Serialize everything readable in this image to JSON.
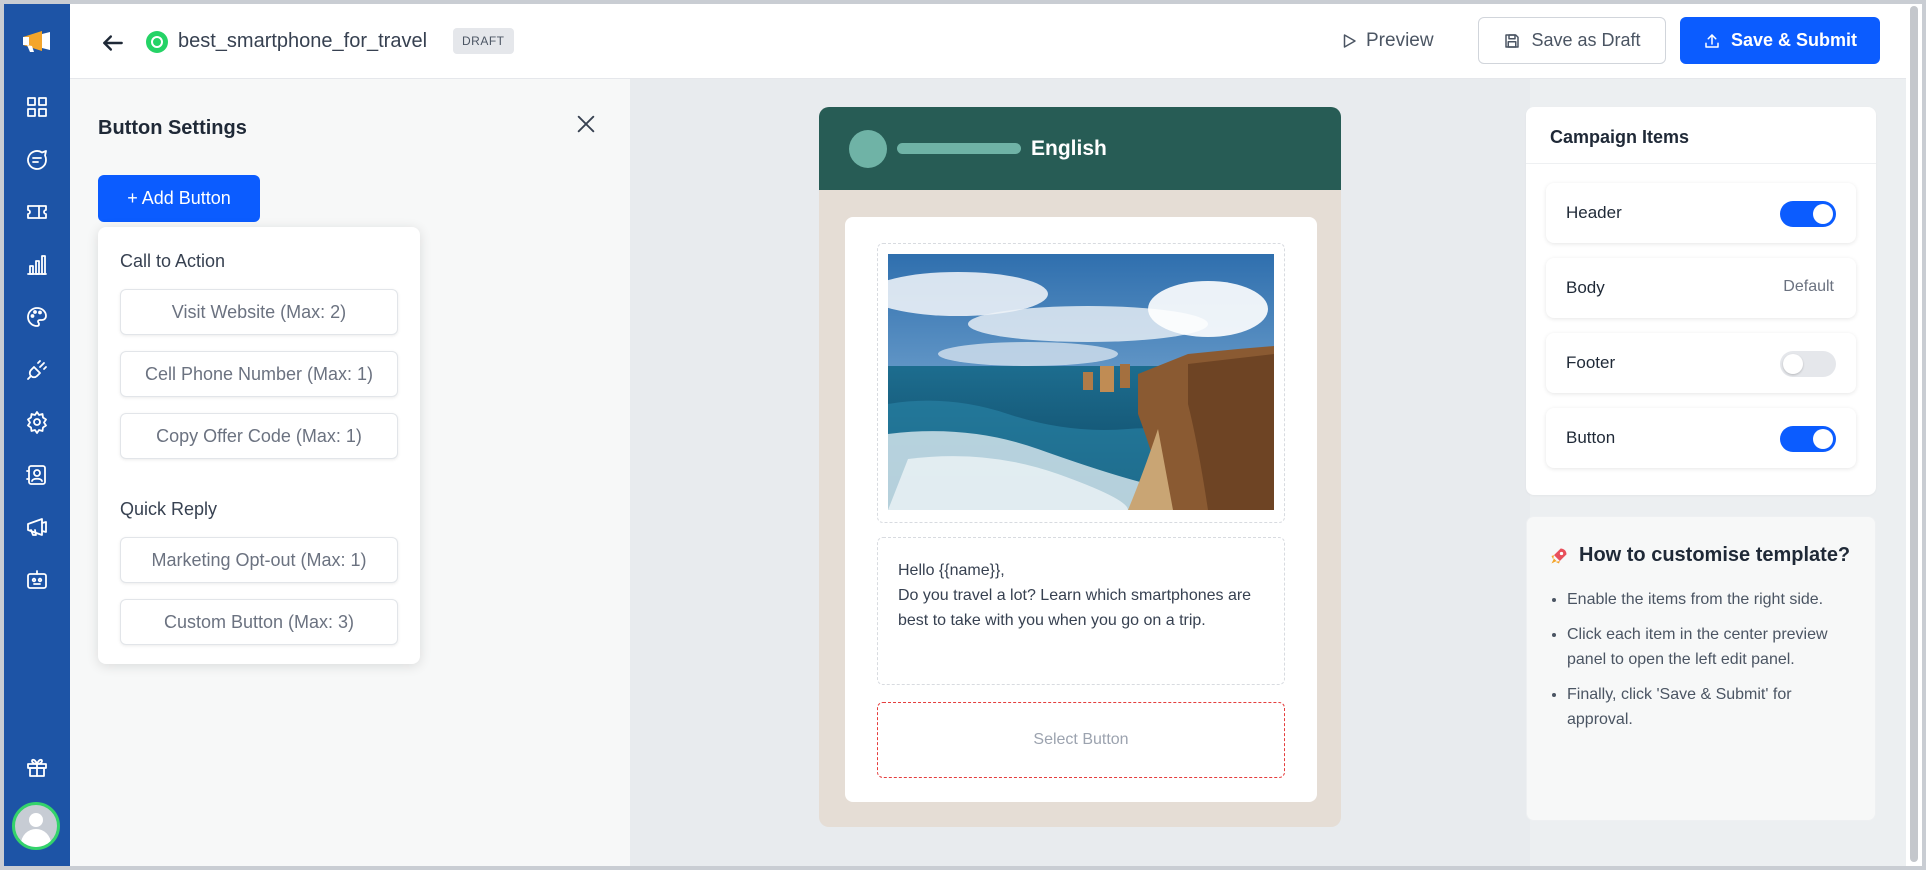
{
  "header": {
    "template_name": "best_smartphone_for_travel",
    "status_badge": "DRAFT",
    "preview_label": "Preview",
    "save_draft_label": "Save as Draft",
    "submit_label": "Save & Submit"
  },
  "sidebar": {
    "items": [
      "dashboard-icon",
      "chat-icon",
      "ticket-icon",
      "analytics-icon",
      "palette-icon",
      "plugin-icon",
      "settings-icon",
      "contacts-icon",
      "campaign-icon",
      "bot-icon"
    ],
    "bottom": [
      "gift-icon",
      "avatar"
    ]
  },
  "button_settings": {
    "title": "Button Settings",
    "add_button_label": "+ Add Button",
    "call_to_action_heading": "Call to Action",
    "call_to_action_options": [
      "Visit Website (Max: 2)",
      "Cell Phone Number (Max: 1)",
      "Copy Offer Code (Max: 1)"
    ],
    "quick_reply_heading": "Quick Reply",
    "quick_reply_options": [
      "Marketing Opt-out (Max: 1)",
      "Custom Button (Max: 3)"
    ]
  },
  "preview": {
    "language": "English",
    "body_lines": [
      "Hello {{name}},",
      "Do you travel a lot? Learn which smartphones are best to take with you when you go on a trip."
    ],
    "select_button_label": "Select Button"
  },
  "campaign_items": {
    "title": "Campaign Items",
    "rows": [
      {
        "label": "Header",
        "type": "toggle",
        "on": true
      },
      {
        "label": "Body",
        "type": "value",
        "value": "Default"
      },
      {
        "label": "Footer",
        "type": "toggle",
        "on": false
      },
      {
        "label": "Button",
        "type": "toggle",
        "on": true
      }
    ]
  },
  "help": {
    "title": "How to customise template?",
    "icon": "rocket-icon",
    "steps": [
      "Enable the items from the right side.",
      "Click each item in the center preview panel to open the left edit panel.",
      "Finally, click 'Save & Submit' for approval."
    ]
  },
  "colors": {
    "sidebar": "#1d54a6",
    "primary": "#0b5cff",
    "whatsapp_header": "#275c55",
    "chat_bg": "#e5ddd5"
  }
}
